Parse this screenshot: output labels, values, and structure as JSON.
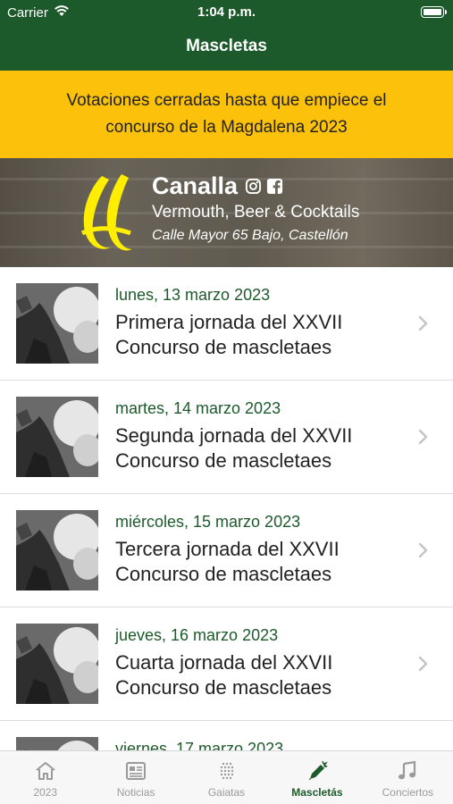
{
  "status_bar": {
    "carrier": "Carrier",
    "time": "1:04 p.m."
  },
  "nav": {
    "title": "Mascletas"
  },
  "banner": {
    "line1": "Votaciones cerradas hasta que empiece el",
    "line2": "concurso de la Magdalena 2023"
  },
  "ad": {
    "name": "Canalla",
    "tagline": "Vermouth, Beer & Cocktails",
    "address": "Calle Mayor 65 Bajo, Castellón",
    "logo_color": "#ffee00"
  },
  "events": [
    {
      "date": "lunes, 13 marzo 2023",
      "title": "Primera jornada del XXVII Concurso de mascletaes"
    },
    {
      "date": "martes, 14 marzo 2023",
      "title": "Segunda jornada del XXVII Concurso de mascletaes"
    },
    {
      "date": "miércoles, 15 marzo 2023",
      "title": "Tercera jornada del XXVII Concurso de mascletaes"
    },
    {
      "date": "jueves, 16 marzo 2023",
      "title": "Cuarta jornada del XXVII Concurso de mascletaes"
    },
    {
      "date": "viernes, 17 marzo 2023",
      "title": ""
    }
  ],
  "tabs": [
    {
      "label": "2023",
      "icon": "home-icon",
      "active": false
    },
    {
      "label": "Noticias",
      "icon": "newspaper-icon",
      "active": false
    },
    {
      "label": "Gaiatas",
      "icon": "lights-grid-icon",
      "active": false
    },
    {
      "label": "Mascletás",
      "icon": "firework-pencil-icon",
      "active": true
    },
    {
      "label": "Conciertos",
      "icon": "music-note-icon",
      "active": false
    }
  ],
  "colors": {
    "primary": "#1d5a2b",
    "banner": "#fcc10b",
    "tab_inactive": "#9a9a9a"
  }
}
